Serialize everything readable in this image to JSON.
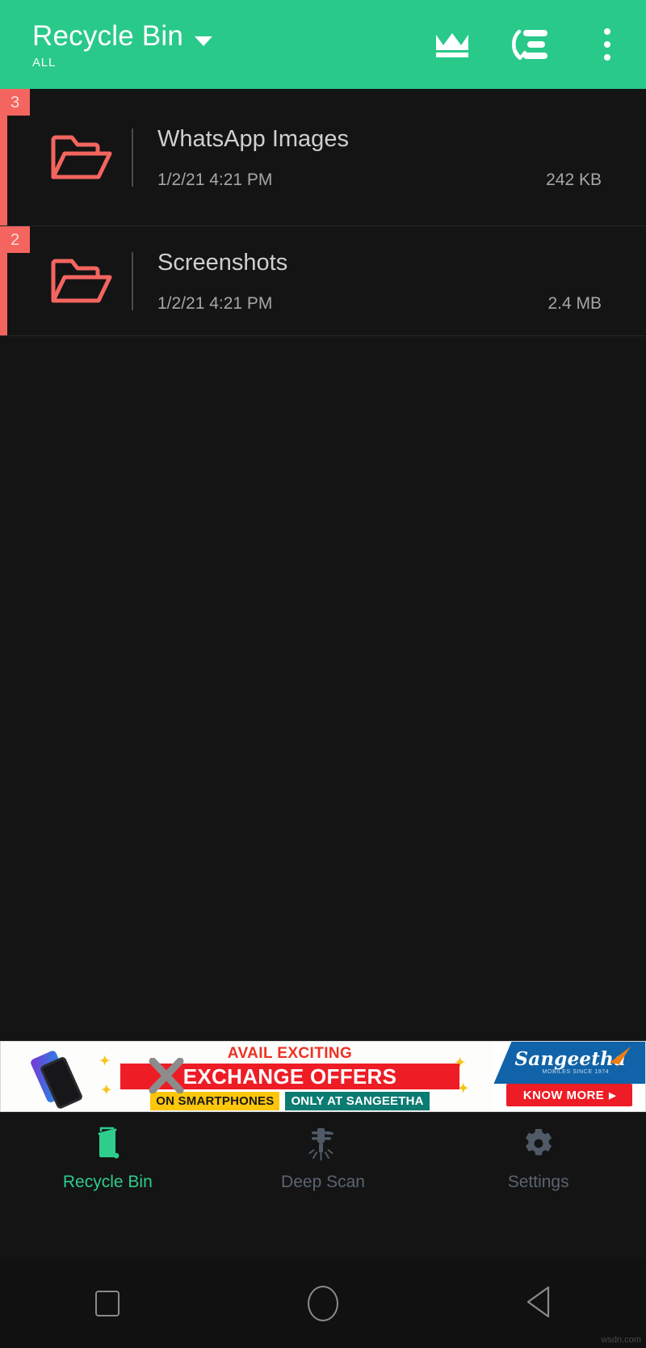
{
  "header": {
    "title": "Recycle Bin",
    "subtitle": "ALL",
    "dropdown_icon": "chevron-down-icon",
    "actions": [
      {
        "name": "premium-crown-button",
        "icon": "crown-icon"
      },
      {
        "name": "sort-button",
        "icon": "sort-list-icon"
      },
      {
        "name": "overflow-menu-button",
        "icon": "kebab-menu-icon"
      }
    ],
    "background_color": "#29c98a",
    "text_color": "#ffffff"
  },
  "list": {
    "accent_color": "#f4655f",
    "items": [
      {
        "badge": "3",
        "title": "WhatsApp Images",
        "date": "1/2/21 4:21 PM",
        "size": "242 KB",
        "icon": "open-folder-icon"
      },
      {
        "badge": "2",
        "title": "Screenshots",
        "date": "1/2/21 4:21 PM",
        "size": "2.4 MB",
        "icon": "open-folder-icon"
      }
    ]
  },
  "ad": {
    "headline": "AVAIL EXCITING",
    "banner_text": "EXCHANGE OFFERS",
    "tag_left": "ON SMARTPHONES",
    "tag_right": "ONLY AT SANGEETHA",
    "brand": "Sangeetha",
    "brand_tagline": "MOBILES   SINCE 1974",
    "cta": "KNOW MORE",
    "cta_arrow": "▶",
    "colors": {
      "red": "#ee1c25",
      "yellow": "#fcc60a",
      "teal": "#0c7b72",
      "blue": "#1063a8"
    }
  },
  "bottom_nav": {
    "active_color": "#2ecd8d",
    "idle_color": "#5b6470",
    "items": [
      {
        "label": "Recycle Bin",
        "icon": "trash-bin-icon",
        "active": true
      },
      {
        "label": "Deep Scan",
        "icon": "jackhammer-icon",
        "active": false
      },
      {
        "label": "Settings",
        "icon": "gear-icon",
        "active": false
      }
    ]
  },
  "system_nav": {
    "recents": "square-icon",
    "home": "circle-icon",
    "back": "triangle-back-icon"
  },
  "watermark": "wsdn.com"
}
